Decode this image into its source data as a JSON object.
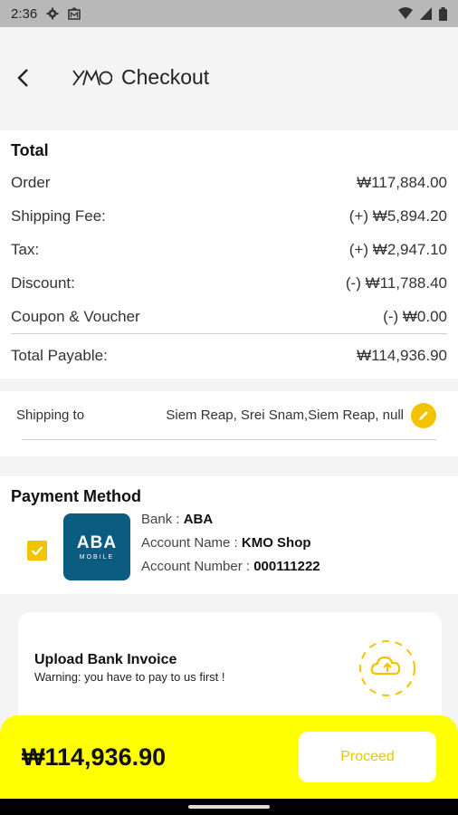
{
  "status_bar": {
    "time": "2:36"
  },
  "header": {
    "logo": "KMO",
    "title": "Checkout"
  },
  "total": {
    "title": "Total",
    "rows": [
      {
        "label": "Order",
        "value": "₩117,884.00"
      },
      {
        "label": "Shipping Fee:",
        "value": "(+) ₩5,894.20"
      },
      {
        "label": "Tax:",
        "value": "(+) ₩2,947.10"
      },
      {
        "label": "Discount:",
        "value": "(-) ₩11,788.40"
      },
      {
        "label": "Coupon & Voucher",
        "value": "(-) ₩0.00"
      }
    ],
    "payable_label": "Total Payable:",
    "payable_value": "₩114,936.90"
  },
  "shipping": {
    "label": "Shipping to",
    "address": "Siem Reap, Srei Snam,Siem Reap, null"
  },
  "payment": {
    "title": "Payment Method",
    "bank_logo_text": "ABA",
    "bank_logo_sub": "MOBILE",
    "bank_label": "Bank : ",
    "bank_value": "ABA",
    "account_name_label": "Account Name : ",
    "account_name_value": "KMO Shop",
    "account_number_label": "Account Number : ",
    "account_number_value": "000111222",
    "selected": true
  },
  "upload": {
    "title": "Upload Bank Invoice",
    "warning": "Warning: you have to pay to us first !"
  },
  "footer": {
    "total": "₩114,936.90",
    "proceed_label": "Proceed"
  },
  "colors": {
    "accent": "#f3c300",
    "footer_bg": "#ffff00",
    "bank": "#0c5c82"
  }
}
